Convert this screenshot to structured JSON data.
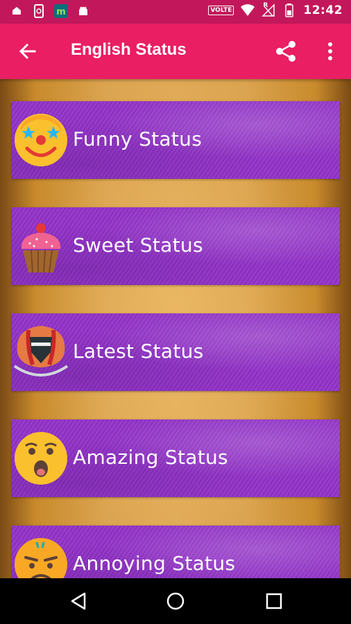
{
  "status_bar": {
    "volte_badge": "VOLTE",
    "roaming_indicator": "R",
    "time": "12:42",
    "icons": [
      "notification-bell-icon",
      "phone-sync-icon",
      "app-m-icon",
      "android-icon",
      "wifi-icon",
      "signal-icon",
      "battery-icon"
    ]
  },
  "toolbar": {
    "title": "English Status",
    "back_icon": "arrow-back-icon",
    "share_icon": "share-icon",
    "more_icon": "more-vert-icon",
    "color": "#e91e63"
  },
  "categories": [
    {
      "label": "Funny Status",
      "icon": "clown-face-icon"
    },
    {
      "label": "Sweet Status",
      "icon": "cupcake-icon"
    },
    {
      "label": "Latest Status",
      "icon": "hot-air-balloon-icon"
    },
    {
      "label": "Amazing Status",
      "icon": "surprised-face-icon"
    },
    {
      "label": "Annoying Status",
      "icon": "annoyed-face-icon"
    }
  ],
  "nav_bar": {
    "back_icon": "nav-back-triangle-icon",
    "home_icon": "nav-home-circle-icon",
    "recents_icon": "nav-recents-square-icon"
  },
  "colors": {
    "status_bar": "#c2185b",
    "toolbar": "#e91e63",
    "card": "#9333c9",
    "background_wood": "#dba450"
  }
}
